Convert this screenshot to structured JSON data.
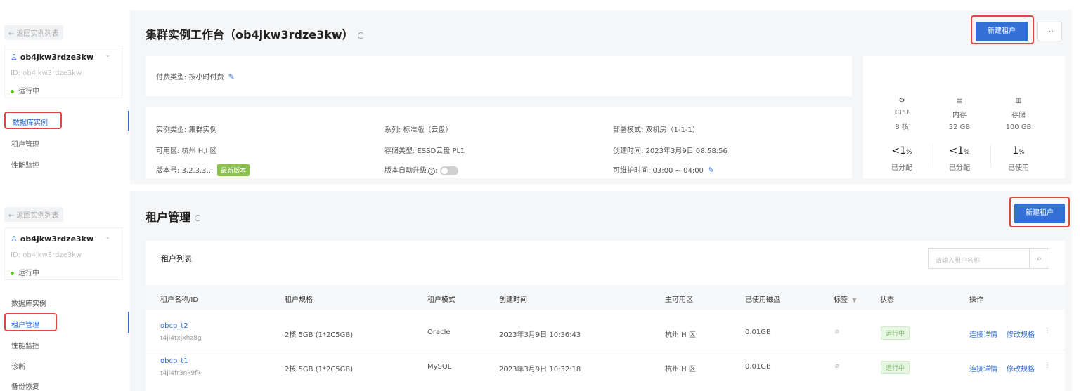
{
  "top": {
    "sidebar": {
      "back_label": "← 返回实例列表",
      "instance_name": "ob4jkw3rdze3kw",
      "instance_id": "ID: ob4jkw3rdze3kw",
      "status": "运行中",
      "nav": [
        "数据库实例",
        "租户管理",
        "性能监控"
      ]
    },
    "title": "集群实例工作台（ob4jkw3rdze3kw）",
    "new_tenant_button": "新建租户",
    "more_button": "···",
    "billing": {
      "label": "付费类型:",
      "value": "按小时付费"
    },
    "info": {
      "instance_type": "实例类型:  集群实例",
      "zone": "可用区:  杭州 H,I 区",
      "version": "版本号:  3.2.3.3...",
      "version_tag": "最新版本",
      "series": "系列:  标准版（云盘）",
      "storage_type": "存储类型:  ESSD云盘 PL1",
      "auto_upgrade": "版本自动升级",
      "deploy_mode": "部署模式:  双机房（1-1-1）",
      "created": "创建时间:  2023年3月9日 08:58:56",
      "maintenance": "可维护时间:  03:00 ~ 04:00"
    },
    "resources": [
      {
        "icon": "⚙",
        "name": "CPU",
        "value": "8 核",
        "pct": "<1",
        "unit": "%",
        "sub": "已分配"
      },
      {
        "icon": "▤",
        "name": "内存",
        "value": "32 GB",
        "pct": "<1",
        "unit": "%",
        "sub": "已分配"
      },
      {
        "icon": "▥",
        "name": "存储",
        "value": "100 GB",
        "pct": "1",
        "unit": "%",
        "sub": "已使用"
      }
    ]
  },
  "bottom": {
    "sidebar": {
      "back_label": "← 返回实例列表",
      "instance_name": "ob4jkw3rdze3kw",
      "instance_id": "ID: ob4jkw3rdze3kw",
      "status": "运行中",
      "nav": [
        "数据库实例",
        "租户管理",
        "性能监控",
        "诊断",
        "备份恢复"
      ]
    },
    "title": "租户管理",
    "new_tenant_button": "新建租户",
    "list_title": "租户列表",
    "search_placeholder": "请输入租户名称",
    "columns": [
      "租户名称/ID",
      "租户规格",
      "租户模式",
      "创建时间",
      "主可用区",
      "已使用磁盘",
      "标签",
      "状态",
      "操作"
    ],
    "rows": [
      {
        "name": "obcp_t2",
        "id": "t4jl4txjxhz8g",
        "spec": "2核 5GB (1*2C5GB)",
        "mode": "Oracle",
        "created": "2023年3月9日 10:36:43",
        "zone": "杭州 H 区",
        "disk": "0.01GB",
        "status": "运行中",
        "act1": "连接详情",
        "act2": "修改规格"
      },
      {
        "name": "obcp_t1",
        "id": "t4jl4fr3nk9fk",
        "spec": "2核 5GB (1*2C5GB)",
        "mode": "MySQL",
        "created": "2023年3月9日 10:32:18",
        "zone": "杭州 H 区",
        "disk": "0.01GB",
        "status": "运行中",
        "act1": "连接详情",
        "act2": "修改规格"
      }
    ]
  }
}
